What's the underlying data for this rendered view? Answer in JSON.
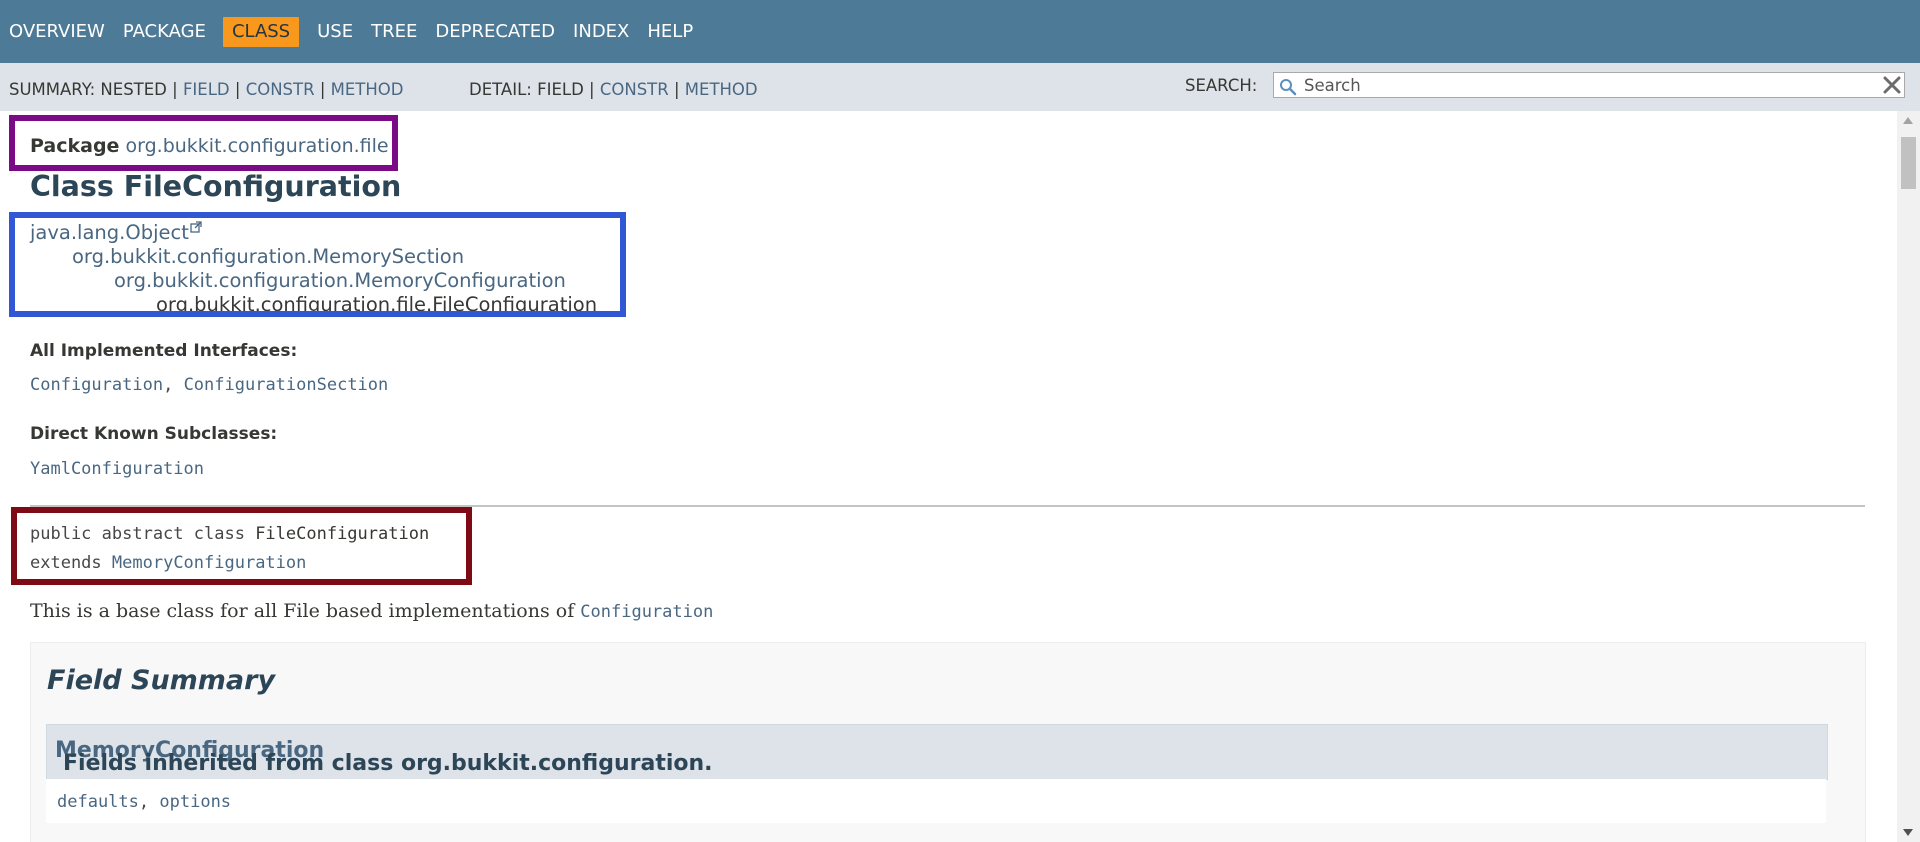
{
  "topnav": {
    "items": [
      "OVERVIEW",
      "PACKAGE",
      "CLASS",
      "USE",
      "TREE",
      "DEPRECATED",
      "INDEX",
      "HELP"
    ],
    "active": "CLASS"
  },
  "subnav": {
    "summary_label": "SUMMARY:",
    "summary_nested": "NESTED",
    "summary_field": "FIELD",
    "summary_constr": "CONSTR",
    "summary_method": "METHOD",
    "detail_label": "DETAIL:",
    "detail_field": "FIELD",
    "detail_constr": "CONSTR",
    "detail_method": "METHOD",
    "separator": "|"
  },
  "search": {
    "label": "SEARCH:",
    "placeholder": "Search",
    "reset_icon": "close-icon"
  },
  "header": {
    "package_keyword": "Package",
    "package_name": "org.bukkit.configuration.file",
    "class_title": "Class FileConfiguration"
  },
  "inheritance": [
    "java.lang.Object",
    "org.bukkit.configuration.MemorySection",
    "org.bukkit.configuration.MemoryConfiguration",
    "org.bukkit.configuration.file.FileConfiguration"
  ],
  "interfaces": {
    "heading": "All Implemented Interfaces:",
    "first": "Configuration",
    "second": "ConfigurationSection",
    "separator": ","
  },
  "subclasses": {
    "heading": "Direct Known Subclasses:",
    "first": "YamlConfiguration"
  },
  "signature": {
    "modifiers": "public abstract class",
    "name": "FileConfiguration",
    "extends_kw": "extends",
    "extends_name": "MemoryConfiguration"
  },
  "description": {
    "text": "This is a base class for all File based implementations of",
    "link": "Configuration"
  },
  "field_summary": {
    "title": "Field Summary",
    "inherited_prefix": "Fields inherited from class org.bukkit.configuration.",
    "inherited_link": "MemoryConfiguration",
    "field_one": "defaults",
    "field_two": "options",
    "separator": ","
  },
  "colors": {
    "nav_bg": "#4d7a97",
    "nav_active": "#f8981d",
    "subnav_bg": "#dee3e9",
    "link": "#4a6782",
    "heading": "#2c4557",
    "highlight_purple": "#7b0a87",
    "highlight_blue": "#3157d5",
    "highlight_red": "#7e0a14"
  }
}
